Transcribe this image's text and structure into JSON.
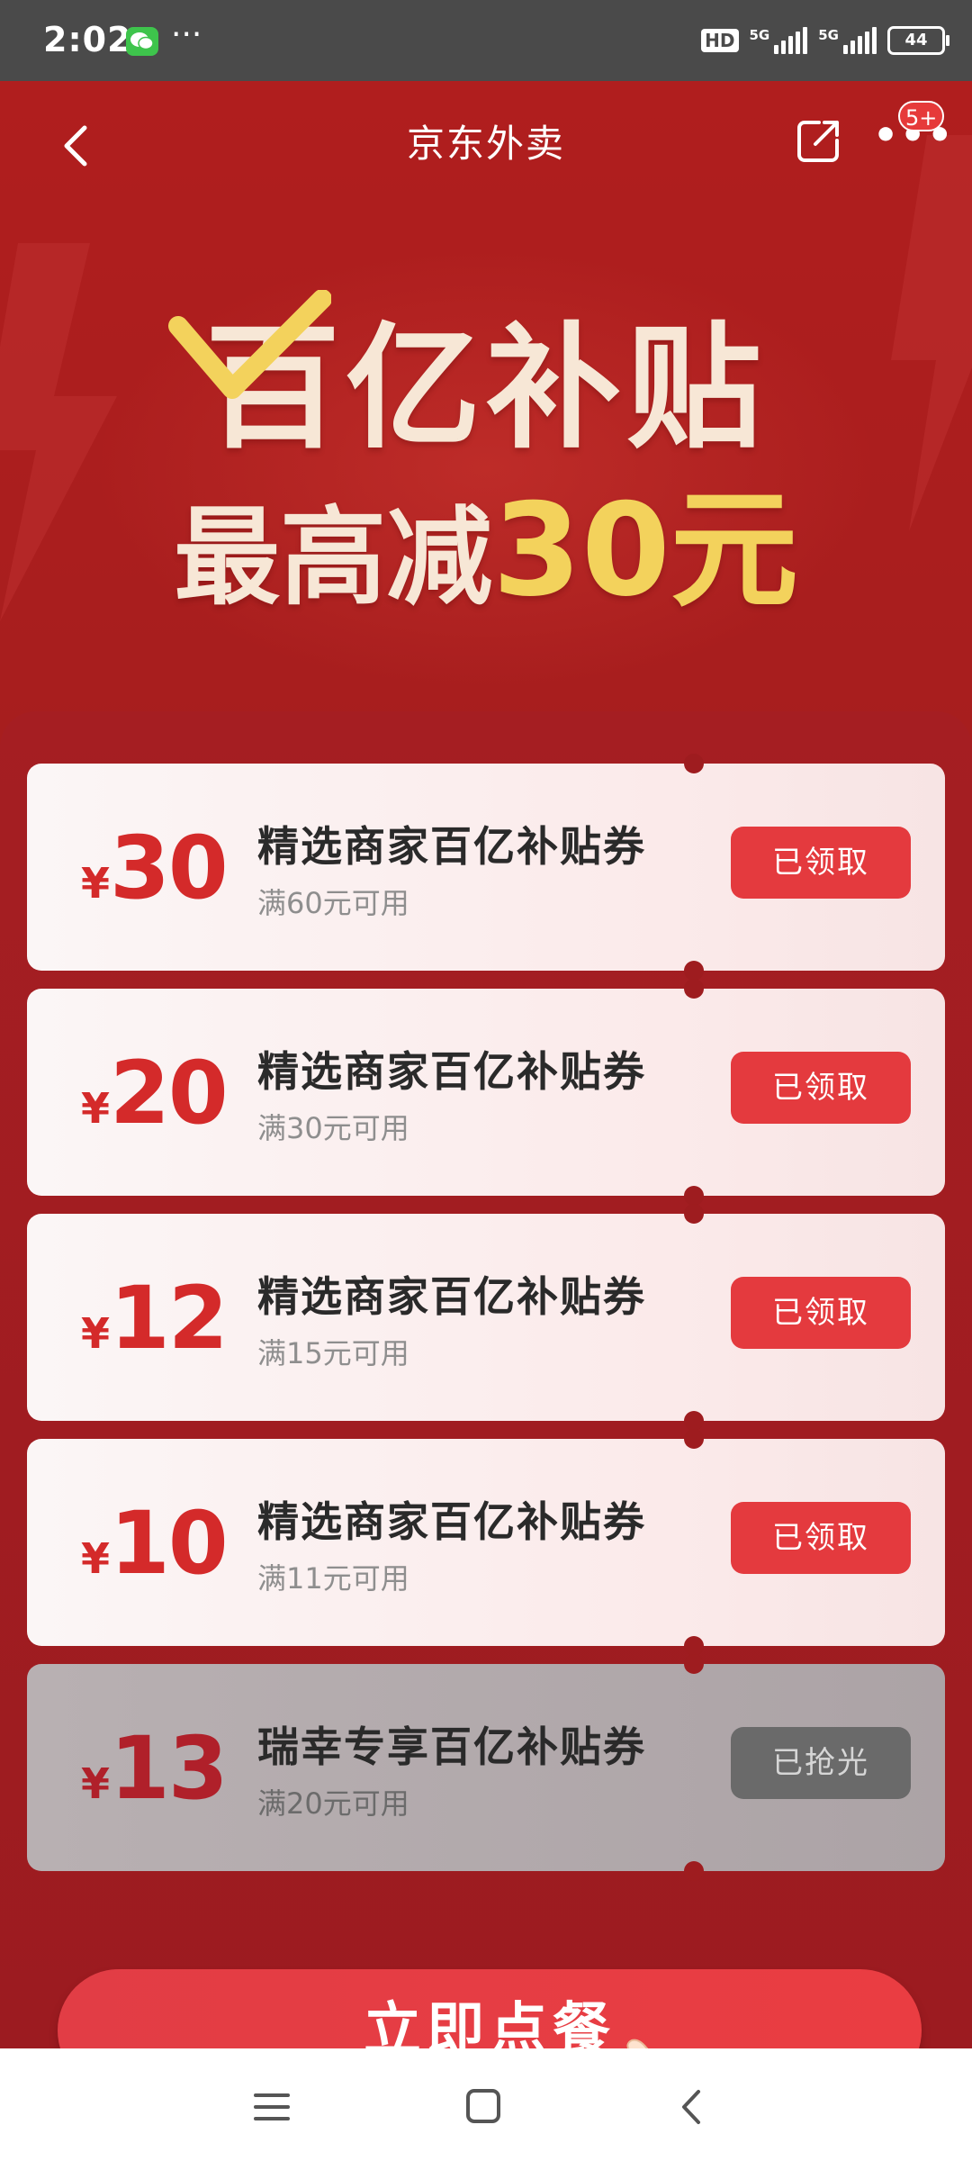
{
  "status_bar": {
    "time": "2:02",
    "dots": "···",
    "hd": "HD",
    "signal1": "5G",
    "signal2": "5G",
    "battery": "44"
  },
  "nav": {
    "title": "京东外卖",
    "badge": "5+"
  },
  "hero": {
    "headline": "百亿补贴",
    "subline_prefix": "最高减",
    "subline_amount": "30元"
  },
  "coupons": [
    {
      "currency": "¥",
      "amount": "30",
      "title": "精选商家百亿补贴券",
      "condition": "满60元可用",
      "button": "已领取"
    },
    {
      "currency": "¥",
      "amount": "20",
      "title": "精选商家百亿补贴券",
      "condition": "满30元可用",
      "button": "已领取"
    },
    {
      "currency": "¥",
      "amount": "12",
      "title": "精选商家百亿补贴券",
      "condition": "满15元可用",
      "button": "已领取"
    },
    {
      "currency": "¥",
      "amount": "10",
      "title": "精选商家百亿补贴券",
      "condition": "满11元可用",
      "button": "已领取"
    },
    {
      "currency": "¥",
      "amount": "13",
      "title": "瑞幸专享百亿补贴券",
      "condition": "满20元可用",
      "button": "已抢光"
    }
  ],
  "cta": {
    "label": "立即点餐"
  },
  "icons": {
    "back": "back-arrow-icon",
    "share": "share-icon",
    "more": "more-icon",
    "hand": "pointing-hand-icon",
    "menu": "menu-icon",
    "home": "home-square-icon",
    "sys_back": "system-back-icon"
  },
  "colors": {
    "brand_red": "#e43a3e",
    "hero_bg": "#a81e1e",
    "headline": "#f7e7d6",
    "accent_gold": "#f3d25c",
    "disabled_button": "#6a6a6a"
  }
}
